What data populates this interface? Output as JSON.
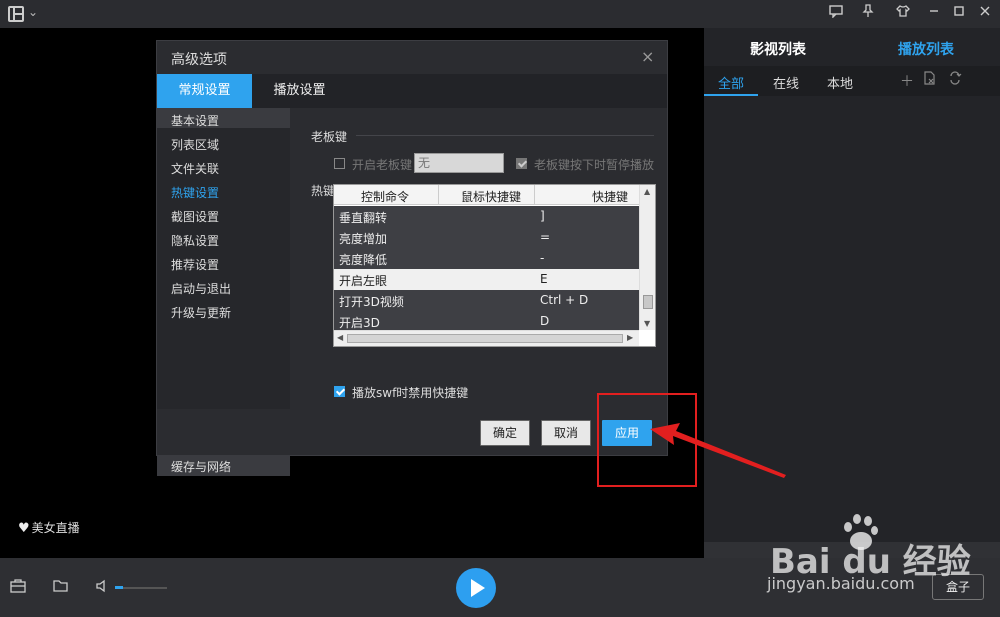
{
  "window": {
    "menu_icon": "layout-icon",
    "chevron": "⌄",
    "controls": [
      "feedback-icon",
      "pin-icon",
      "skin-icon",
      "minimize-icon",
      "maximize-icon",
      "close-icon"
    ]
  },
  "video": {
    "live_badge_label": "美女直播"
  },
  "right_panel": {
    "tabs": [
      "影视列表",
      "播放列表"
    ],
    "active_tab": "播放列表",
    "subtabs": [
      "全部",
      "在线",
      "本地"
    ],
    "active_subtab": "全部"
  },
  "dialog": {
    "title": "高级选项",
    "close": "×",
    "tabs": [
      "常规设置",
      "播放设置"
    ],
    "sidebar": [
      "基本设置",
      "列表区域",
      "文件关联",
      "热键设置",
      "截图设置",
      "隐私设置",
      "推荐设置",
      "启动与退出",
      "升级与更新"
    ],
    "sidebar_bottom": "缓存与网络",
    "boss_key": {
      "section": "老板键",
      "enable_label": "开启老板键",
      "key_value": "无",
      "pause_label": "老板键按下时暂停播放"
    },
    "hotkeys": {
      "section": "热键设置",
      "columns": [
        "控制命令",
        "鼠标快捷键",
        "快捷键"
      ],
      "rows": [
        {
          "cmd": "垂直翻转",
          "key": "]"
        },
        {
          "cmd": "亮度增加",
          "key": "="
        },
        {
          "cmd": "亮度降低",
          "key": "-"
        },
        {
          "cmd": "开启左眼",
          "key": "E"
        },
        {
          "cmd": "打开3D视频",
          "key": "Ctrl + D"
        },
        {
          "cmd": "开启3D",
          "key": "D"
        }
      ],
      "swf_label": "播放swf时禁用快捷键"
    },
    "buttons": {
      "ok": "确定",
      "cancel": "取消",
      "apply": "应用"
    }
  },
  "bottom_bar": {
    "box_label": "盒子"
  },
  "watermark": {
    "brand": "Bai  du 经验",
    "url": "jingyan.baidu.com"
  },
  "colors": {
    "accent": "#2fa3ee",
    "annotation": "#e21f1f"
  }
}
